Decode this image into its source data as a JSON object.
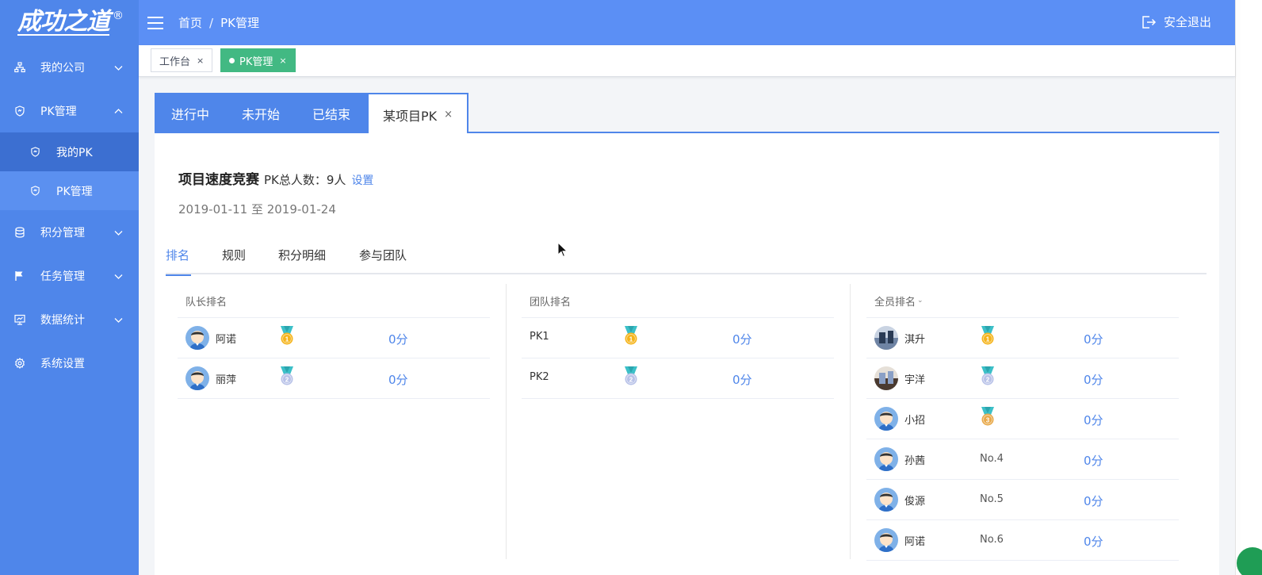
{
  "sidebar": {
    "logo_text": "成功之道",
    "logo_mark": "®",
    "items": [
      {
        "label": "我的公司",
        "icon": "org-chart-icon"
      },
      {
        "label": "PK管理",
        "icon": "shield-icon"
      },
      {
        "label": "积分管理",
        "icon": "database-icon"
      },
      {
        "label": "任务管理",
        "icon": "flag-icon"
      },
      {
        "label": "数据统计",
        "icon": "monitor-icon"
      },
      {
        "label": "系统设置",
        "icon": "gear-icon"
      }
    ],
    "sub_items": [
      {
        "label": "我的PK",
        "icon": "shield-icon"
      },
      {
        "label": "PK管理",
        "icon": "shield-icon"
      }
    ]
  },
  "header": {
    "breadcrumb_home": "首页",
    "breadcrumb_sep": "/",
    "breadcrumb_current": "PK管理",
    "logout_label": "安全退出"
  },
  "tags": [
    {
      "label": "工作台",
      "close": "×"
    },
    {
      "label": "PK管理",
      "close": "×"
    }
  ],
  "card_tabs": [
    {
      "label": "进行中"
    },
    {
      "label": "未开始"
    },
    {
      "label": "已结束"
    },
    {
      "label": "某项目PK",
      "close": "×"
    }
  ],
  "pk": {
    "name": "项目速度竞赛",
    "count_label": "PK总人数：9人",
    "settings_link": "设置",
    "date_range": "2019-01-11 至 2019-01-24"
  },
  "sub_tabs": [
    {
      "label": "排名"
    },
    {
      "label": "规则"
    },
    {
      "label": "积分明细"
    },
    {
      "label": "参与团队"
    }
  ],
  "captain_ranking": {
    "title": "队长排名",
    "rows": [
      {
        "name": "阿诺",
        "medal": "gold",
        "rank": "1",
        "score": "0分"
      },
      {
        "name": "丽萍",
        "medal": "silver",
        "rank": "2",
        "score": "0分"
      }
    ]
  },
  "team_ranking": {
    "title": "团队排名",
    "rows": [
      {
        "name": "PK1",
        "medal": "gold",
        "rank": "1",
        "score": "0分"
      },
      {
        "name": "PK2",
        "medal": "silver",
        "rank": "2",
        "score": "0分"
      }
    ]
  },
  "all_ranking": {
    "title": "全员排名",
    "caret": "⌄",
    "rows": [
      {
        "name": "淇升",
        "medal": "gold",
        "rank": "1",
        "score": "0分",
        "avatar": "photo"
      },
      {
        "name": "宇洋",
        "medal": "silver",
        "rank": "2",
        "score": "0分",
        "avatar": "photo"
      },
      {
        "name": "小招",
        "medal": "bronze",
        "rank": "3",
        "score": "0分",
        "avatar": "cartoon"
      },
      {
        "name": "孙茜",
        "no": "No.4",
        "score": "0分",
        "avatar": "cartoon"
      },
      {
        "name": "俊源",
        "no": "No.5",
        "score": "0分",
        "avatar": "cartoon"
      },
      {
        "name": "阿诺",
        "no": "No.6",
        "score": "0分",
        "avatar": "cartoon"
      }
    ]
  },
  "colors": {
    "sidebar": "#4f86ea",
    "header": "#5b8ff5",
    "accent": "#4f86ea",
    "tag_active": "#42b983",
    "medal_gold": "#f5b41b",
    "medal_silver": "#b8c2e8",
    "medal_bronze": "#e8a94a",
    "ribbon": "#3cc0c8"
  }
}
